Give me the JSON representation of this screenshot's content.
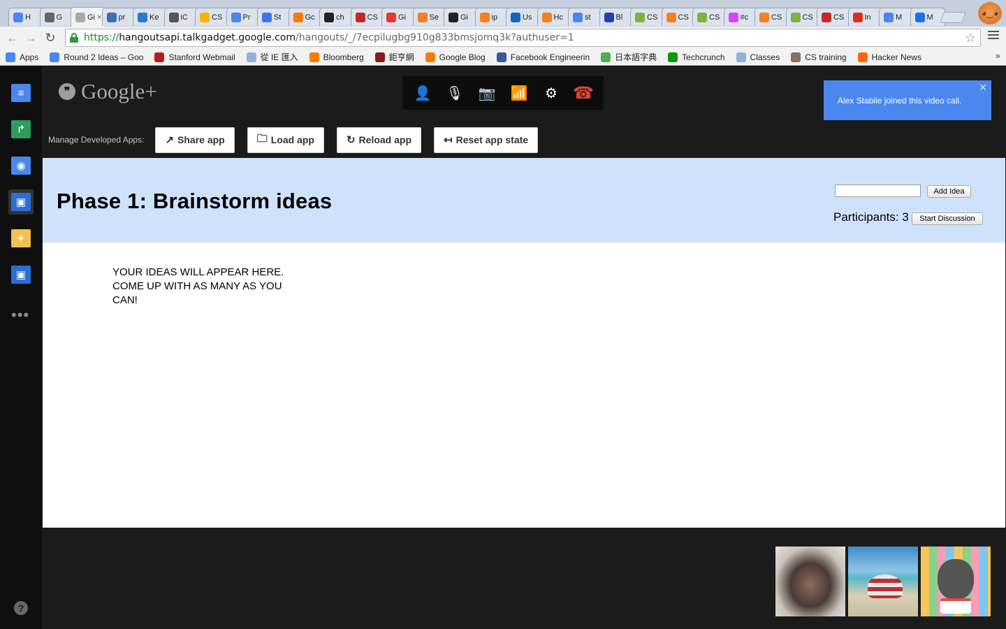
{
  "browser": {
    "tabs": [
      {
        "label": "H",
        "color": "#4a87ee"
      },
      {
        "label": "G",
        "color": "#666666"
      },
      {
        "label": "Gi",
        "color": "#aaaaaa",
        "active": true,
        "close": "×"
      },
      {
        "label": "pr",
        "color": "#3b6fb8"
      },
      {
        "label": "Ke",
        "color": "#2a7bd0"
      },
      {
        "label": "iC",
        "color": "#555555"
      },
      {
        "label": "CS",
        "color": "#f4b400"
      },
      {
        "label": "Pr",
        "color": "#4a87ee"
      },
      {
        "label": "St",
        "color": "#3b78e7"
      },
      {
        "label": "Gc",
        "color": "#f57c00"
      },
      {
        "label": "ch",
        "color": "#222222"
      },
      {
        "label": "CS",
        "color": "#c62828"
      },
      {
        "label": "Gi",
        "color": "#e53935"
      },
      {
        "label": "Se",
        "color": "#f48024"
      },
      {
        "label": "Gi",
        "color": "#222222"
      },
      {
        "label": "ip",
        "color": "#f48024"
      },
      {
        "label": "Us",
        "color": "#1565c0"
      },
      {
        "label": "Hc",
        "color": "#f48024"
      },
      {
        "label": "st",
        "color": "#4a87ee"
      },
      {
        "label": "Bl",
        "color": "#1e40af"
      },
      {
        "label": "CS",
        "color": "#7cb342"
      },
      {
        "label": "CS",
        "color": "#f48024"
      },
      {
        "label": "CS",
        "color": "#7cb342"
      },
      {
        "label": "#c",
        "color": "#e040fb"
      },
      {
        "label": "CS",
        "color": "#f48024"
      },
      {
        "label": "CS",
        "color": "#7cb342"
      },
      {
        "label": "CS",
        "color": "#c62828"
      },
      {
        "label": "In",
        "color": "#d93025"
      },
      {
        "label": "M",
        "color": "#4a87ee"
      },
      {
        "label": "M",
        "color": "#1a73e8"
      }
    ],
    "url": {
      "scheme": "https://",
      "host": "hangoutsapi.talkgadget.google.com",
      "path": "/hangouts/_/7ecpilugbg910g833bmsjomq3k?authuser=1"
    },
    "nav": {
      "back": "←",
      "forward": "→",
      "reload": "↻",
      "star": "☆"
    },
    "bookmarks": [
      {
        "label": "Apps",
        "color": "#4a87ee"
      },
      {
        "label": "Round 2 Ideas – Goo",
        "color": "#4a87ee"
      },
      {
        "label": "Stanford Webmail",
        "color": "#b71c1c"
      },
      {
        "label": "從 IE 匯入",
        "color": "#8fb3dd"
      },
      {
        "label": "Bloomberg",
        "color": "#f57c00"
      },
      {
        "label": "鉅亨網",
        "color": "#8b1a1a"
      },
      {
        "label": "Google Blog",
        "color": "#f57c00"
      },
      {
        "label": "Facebook Engineerin",
        "color": "#3b5998"
      },
      {
        "label": "日本語字典",
        "color": "#4caf50"
      },
      {
        "label": "Techcrunch",
        "color": "#0a9a0a"
      },
      {
        "label": "Classes",
        "color": "#8fb3dd"
      },
      {
        "label": "CS training",
        "color": "#8d6e63"
      },
      {
        "label": "Hacker News",
        "color": "#ff6600"
      }
    ],
    "bookmarks_more": "»"
  },
  "hangout": {
    "logo_text": "Google+",
    "logo_glyph": "❞",
    "rail_apps": [
      {
        "icon": "chat-icon",
        "glyph": "≡",
        "color": "#4a87ee"
      },
      {
        "icon": "screenshare-icon",
        "glyph": "↱",
        "color": "#2e9c5b"
      },
      {
        "icon": "camera-icon",
        "glyph": "◉",
        "color": "#4a87ee"
      },
      {
        "icon": "developer-app-icon",
        "glyph": "▣",
        "color": "#2b6fd6",
        "selected": true
      },
      {
        "icon": "effects-icon",
        "glyph": "✦",
        "color": "#f2c14e"
      },
      {
        "icon": "hangout-app-icon",
        "glyph": "▣",
        "color": "#2b6fd6"
      }
    ],
    "more_apps": "•••",
    "help": "?",
    "controls": [
      {
        "name": "invite-people-icon",
        "glyph": "👤"
      },
      {
        "name": "mute-mic-icon",
        "glyph": "🎙"
      },
      {
        "name": "camera-off-icon",
        "glyph": "📷"
      },
      {
        "name": "bandwidth-icon",
        "glyph": "📶"
      },
      {
        "name": "settings-icon",
        "glyph": "⚙"
      },
      {
        "name": "hang-up-icon",
        "glyph": "☎"
      }
    ],
    "notification": {
      "text": "Alex Stabile joined this video call.",
      "close": "✕"
    },
    "dev": {
      "label": "Manage Developed Apps:",
      "buttons": [
        {
          "label": "Share app",
          "icon": "↗"
        },
        {
          "label": "Load app",
          "icon": "🗀"
        },
        {
          "label": "Reload app",
          "icon": "↻"
        },
        {
          "label": "Reset app state",
          "icon": "↤"
        }
      ]
    }
  },
  "app": {
    "header_color": "#cfe2fc",
    "phase_title": "Phase 1: Brainstorm ideas",
    "idea_input": {
      "value": "",
      "placeholder": ""
    },
    "add_idea_label": "Add Idea",
    "participants_label": "Participants: 3",
    "start_discussion_label": "Start Discussion",
    "placeholder_text": "YOUR IDEAS WILL APPEAR HERE. COME UP WITH AS MANY AS YOU CAN!"
  },
  "colors": {
    "notification": "#4a87ee",
    "hangup": "#e3442f",
    "rail_bg": "#0f0f0f",
    "stage_bg": "#1b1b1b"
  }
}
